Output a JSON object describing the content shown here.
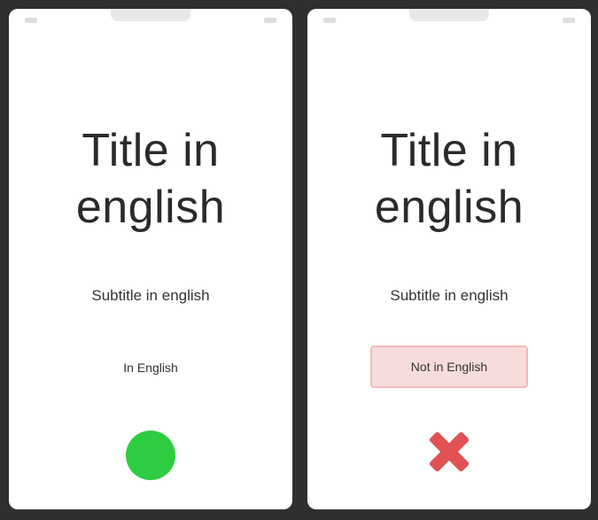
{
  "colors": {
    "frame": "#2f2f2f",
    "screen": "#ffffff",
    "success": "#2ecc40",
    "error": "#e05252",
    "error_fill": "#f7dcdc",
    "error_border": "#f2b8b8"
  },
  "screens": [
    {
      "title": "Title in english",
      "subtitle": "Subtitle in english",
      "input_value": "In English",
      "result": "correct",
      "result_icon": "check-circle-icon"
    },
    {
      "title": "Title in english",
      "subtitle": "Subtitle in english",
      "input_value": "Not in English",
      "result": "incorrect",
      "result_icon": "x-mark-icon"
    }
  ]
}
